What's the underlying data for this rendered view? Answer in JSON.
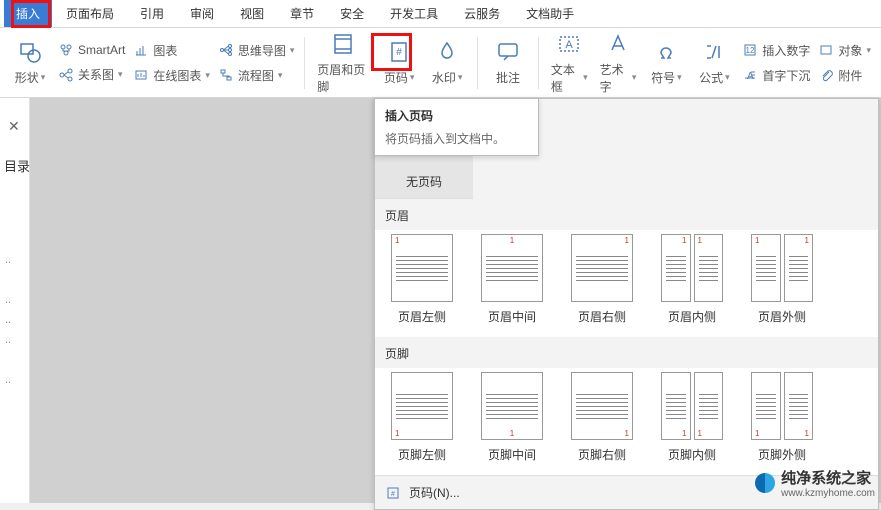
{
  "tabs": [
    "插入",
    "页面布局",
    "引用",
    "审阅",
    "视图",
    "章节",
    "安全",
    "开发工具",
    "云服务",
    "文档助手"
  ],
  "active_tab_index": 0,
  "ribbon": {
    "shapes": "形状",
    "smartart": "SmartArt",
    "chart": "图表",
    "relation": "关系图",
    "online_chart": "在线图表",
    "mindmap": "思维导图",
    "flowchart": "流程图",
    "header_footer": "页眉和页脚",
    "page_number": "页码",
    "watermark": "水印",
    "comments": "批注",
    "textbox": "文本框",
    "wordart": "艺术字",
    "symbol": "符号",
    "equation": "公式",
    "insert_number": "插入数字",
    "object": "对象",
    "dropcap": "首字下沉",
    "attachment": "附件"
  },
  "tooltip": {
    "title": "插入页码",
    "body": "将页码插入到文档中。"
  },
  "dropdown": {
    "no_page": "无页码",
    "header_section": "页眉",
    "footer_section": "页脚",
    "header_options": [
      "页眉左侧",
      "页眉中间",
      "页眉右侧",
      "页眉内侧",
      "页眉外侧"
    ],
    "footer_options": [
      "页脚左侧",
      "页脚中间",
      "页脚右侧",
      "页脚内侧",
      "页脚外侧"
    ],
    "bottom_item": "页码(N)..."
  },
  "sidebar": {
    "mulu": "目录"
  },
  "watermark": {
    "line1": "纯净系统之家",
    "line2": "www.kzmyhome.com"
  }
}
